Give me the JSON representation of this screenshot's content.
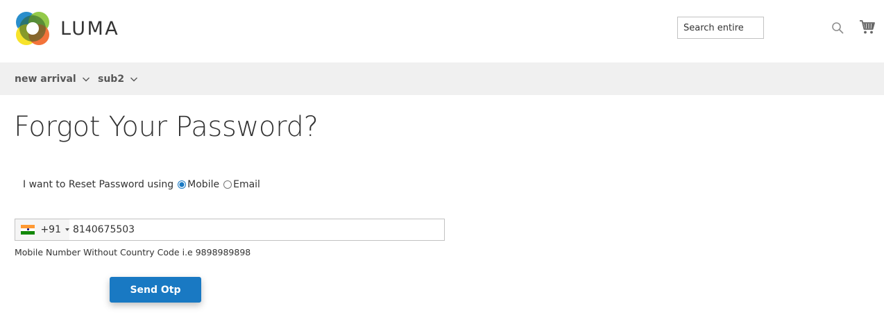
{
  "header": {
    "logo_text": "LUMA",
    "search": {
      "placeholder": "Search entire",
      "value": ""
    },
    "search_icon": "search-icon",
    "cart_icon": "cart-icon"
  },
  "nav": {
    "items": [
      {
        "label": "new arrival",
        "icon": "chevron-down-icon"
      },
      {
        "label": "sub2",
        "icon": "chevron-down-icon"
      }
    ]
  },
  "main": {
    "title": "Forgot Your Password?",
    "reset_prompt": "I want to Reset Password using",
    "options": [
      {
        "label": "Mobile",
        "selected": true
      },
      {
        "label": "Email",
        "selected": false
      }
    ],
    "phone": {
      "country_flag": "india-flag-icon",
      "dial_code": "+91",
      "value": "8140675503"
    },
    "hint": "Mobile Number Without Country Code i.e 9898989898",
    "send_button": "Send Otp"
  },
  "colors": {
    "accent": "#1979c3",
    "nav_bg": "#f0f0f0",
    "text": "#333333"
  }
}
